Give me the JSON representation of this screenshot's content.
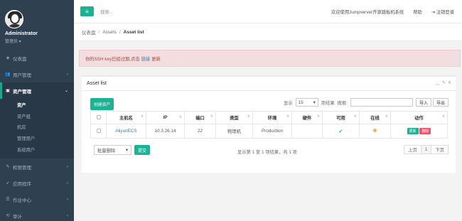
{
  "profile": {
    "name": "Administrator",
    "role": "管理员"
  },
  "nav": {
    "dashboard": "仪表盘",
    "users": "用户管理",
    "assets": "资产管理",
    "asset_sub": [
      "资产",
      "资产组",
      "机房",
      "管理用户",
      "系统用户"
    ],
    "perms": "权限管理",
    "apps": "应用程序",
    "ops": "作业中心",
    "audit": "审计"
  },
  "topbar": {
    "search_placeholder": "搜索...",
    "welcome": "欢迎使用Jumpserver开源跳板机系统",
    "help": "帮助",
    "logout": "注销登录"
  },
  "breadcrumb": {
    "home": "仪表盘",
    "section": "Assets",
    "current": "Asset list"
  },
  "alert": {
    "before": "你的SSH key已经过期,点击",
    "link": "链接",
    "after": "更新"
  },
  "panel": {
    "title": "Asset list",
    "create_button": "创建资产",
    "show_label": "显示",
    "page_size": "15",
    "per_page_label": "项结果",
    "search_label": "搜索:",
    "import_button": "导入",
    "export_button": "导出",
    "columns": [
      "主机名",
      "IP",
      "端口",
      "类型",
      "环境",
      "硬件",
      "可用",
      "在线",
      "动作"
    ],
    "rows": [
      {
        "hostname": "AliyunECS",
        "ip": "10.3.26.14",
        "port": "22",
        "type": "物理机",
        "env": "Production",
        "hardware": "",
        "available": "✔",
        "update": "更新",
        "delete": "删除"
      }
    ],
    "bulk_select": "批量删除",
    "bulk_submit": "提交",
    "page_info": "显示第 1 至 1 项结果，共 1 项",
    "prev": "上页",
    "page": "1",
    "next": "下页"
  },
  "colors": {
    "accent": "#1ab394",
    "sidebar": "#2f4050",
    "danger": "#ed5565",
    "warning": "#f8ac59"
  }
}
